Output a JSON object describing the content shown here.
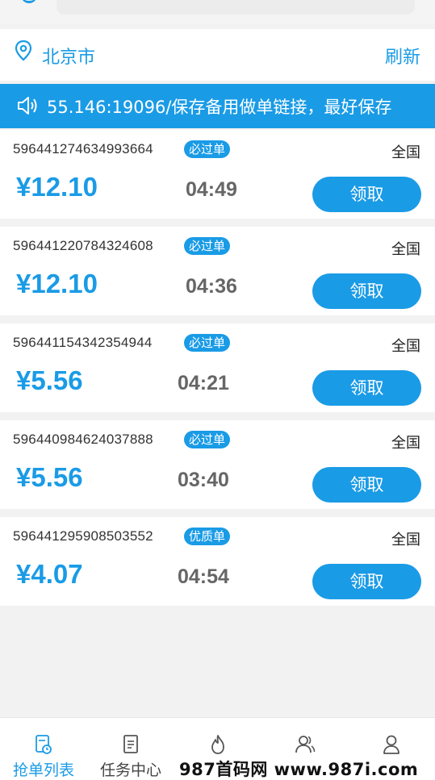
{
  "location": {
    "city": "北京市",
    "refresh_label": "刷新"
  },
  "notice": {
    "text": "55.146:19096/保存备用做单链接，最好保存"
  },
  "orders": [
    {
      "id": "596441274634993664",
      "tag": "必过单",
      "region": "全国",
      "price": "¥12.10",
      "time": "04:49",
      "action": "领取"
    },
    {
      "id": "596441220784324608",
      "tag": "必过单",
      "region": "全国",
      "price": "¥12.10",
      "time": "04:36",
      "action": "领取"
    },
    {
      "id": "596441154342354944",
      "tag": "必过单",
      "region": "全国",
      "price": "¥5.56",
      "time": "04:21",
      "action": "领取"
    },
    {
      "id": "596440984624037888",
      "tag": "必过单",
      "region": "全国",
      "price": "¥5.56",
      "time": "03:40",
      "action": "领取"
    },
    {
      "id": "596441295908503552",
      "tag": "优质单",
      "region": "全国",
      "price": "¥4.07",
      "time": "04:54",
      "action": "领取"
    }
  ],
  "tabbar": {
    "tabs": [
      {
        "label": "抢单列表",
        "icon": "grab-list-icon",
        "active": true
      },
      {
        "label": "任务中心",
        "icon": "document-icon",
        "active": false
      },
      {
        "label": "",
        "icon": "flame-icon",
        "active": false
      },
      {
        "label": "",
        "icon": "team-icon",
        "active": false
      },
      {
        "label": "",
        "icon": "user-icon",
        "active": false
      }
    ]
  },
  "watermark": "987首码网 www.987i.com",
  "colors": {
    "accent": "#1a9be6",
    "background": "#f2f2f2",
    "time_text": "#666666"
  }
}
